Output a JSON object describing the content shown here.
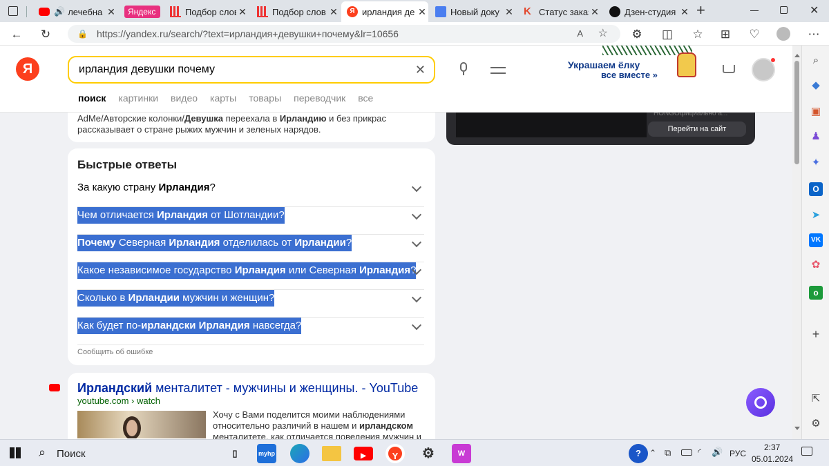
{
  "browser": {
    "tabs": [
      {
        "title": "лечебна",
        "favicon": "youtube",
        "muted": true
      },
      {
        "title": "Яндекс",
        "favicon": "yandex-pink"
      },
      {
        "title": "Подбор слов",
        "favicon": "bars"
      },
      {
        "title": "Подбор слов",
        "favicon": "bars"
      },
      {
        "title": "ирландия де",
        "favicon": "yandex",
        "active": true
      },
      {
        "title": "Новый доку",
        "favicon": "docs"
      },
      {
        "title": "Статус заказ",
        "favicon": "k"
      },
      {
        "title": "Дзен-студия",
        "favicon": "zen"
      }
    ],
    "new_tab": "+",
    "url": "https://yandex.ru/search/?text=ирландия+девушки+почему&lr=10656"
  },
  "page": {
    "search_query": "ирландия девушки почему",
    "nav": [
      "поиск",
      "картинки",
      "видео",
      "карты",
      "товары",
      "переводчик",
      "все"
    ],
    "banner": {
      "line1": "Украшаем ёлку",
      "line2": "все вместе »"
    },
    "prev_snippet": {
      "line1_parts": [
        "AdMe/Авторские колонки/",
        "Девушка",
        " переехала в ",
        "Ирландию",
        " и без прикрас"
      ],
      "line2": "рассказывает о стране рыжих мужчин и зеленых нарядов."
    },
    "video_panel": {
      "button": "Перейти на сайт",
      "faded_text": "HONGOфициально а..."
    },
    "quick_answers": {
      "title": "Быстрые ответы",
      "items": [
        {
          "parts": [
            "За какую страну ",
            "Ирландия",
            "?"
          ],
          "bold": [
            1
          ],
          "selected": false
        },
        {
          "parts": [
            "Чем отличается ",
            "Ирландия",
            " от Шотландии?"
          ],
          "bold": [
            1
          ],
          "selected": true
        },
        {
          "parts": [
            "Почему",
            " Северная ",
            "Ирландия",
            " отделилась от ",
            "Ирландии",
            "?"
          ],
          "bold": [
            0,
            2,
            4
          ],
          "selected": true
        },
        {
          "parts": [
            "Какое независимое государство ",
            "Ирландия",
            " или Северная ",
            "Ирландия",
            "?"
          ],
          "bold": [
            1,
            3
          ],
          "selected": true
        },
        {
          "parts": [
            "Сколько в ",
            "Ирландии",
            " мужчин и женщин?"
          ],
          "bold": [
            1
          ],
          "selected": true
        },
        {
          "parts": [
            "Как будет по-",
            "ирландски Ирландия",
            " навсегда?"
          ],
          "bold": [
            1
          ],
          "selected": true
        }
      ],
      "report": "Сообщить об ошибке"
    },
    "result": {
      "title_bold": "Ирландский",
      "title_rest": " менталитет - мужчины и женщины. - YouTube",
      "domain": "youtube.com",
      "path": "watch",
      "snippet_line1": "Хочу с Вами поделится моими наблюдениями",
      "snippet_line2_parts": [
        "относительно различий в нашем и ",
        "ирландском"
      ],
      "snippet_line3": "менталитете, как отличается поведения мужчин и"
    }
  },
  "taskbar": {
    "search": "Поиск",
    "lang": "РУС",
    "time": "2:37",
    "date": "05.01.2024"
  },
  "colors": {
    "yandex_red": "#fc3f1d",
    "search_border": "#fc0",
    "selection": "#3b6fd1",
    "link": "#0029a3",
    "domain_green": "#006000"
  }
}
